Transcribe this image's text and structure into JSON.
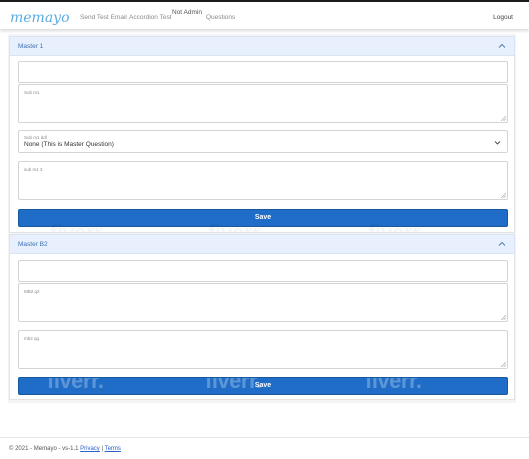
{
  "header": {
    "logo_text": "memayo",
    "nav": {
      "send_test_email": "Send Test Email",
      "accordion_test": "Accordion Test",
      "not_admin": "Not Admin",
      "questions": "Questions"
    },
    "logout": "Logout"
  },
  "sections": [
    {
      "title": "Master 1",
      "fields": [
        {
          "label": "",
          "value": ""
        },
        {
          "label": "Sub m1",
          "value": ""
        },
        {
          "label": "Sub m1 ddl",
          "value": "None (This is Master Question)"
        },
        {
          "label": "sub m1 3",
          "value": ""
        }
      ],
      "save_label": "Save"
    },
    {
      "title": "Master B2",
      "fields": [
        {
          "label": "",
          "value": ""
        },
        {
          "label": "MB2 q2",
          "value": ""
        },
        {
          "label": "mb2 qq",
          "value": ""
        }
      ],
      "save_label": "Save"
    }
  ],
  "watermark": "fiverr.",
  "footer": {
    "copyright": "© 2021 - Memayo - vs-1.1",
    "separator": "|",
    "privacy": "Privacy",
    "terms": "Terms"
  },
  "colors": {
    "accent": "#1f6dc6",
    "accordion_header_bg": "#e7f0fc",
    "accordion_title": "#3b6fb4",
    "logo": "#5aaee3",
    "link": "#2a62c9"
  }
}
